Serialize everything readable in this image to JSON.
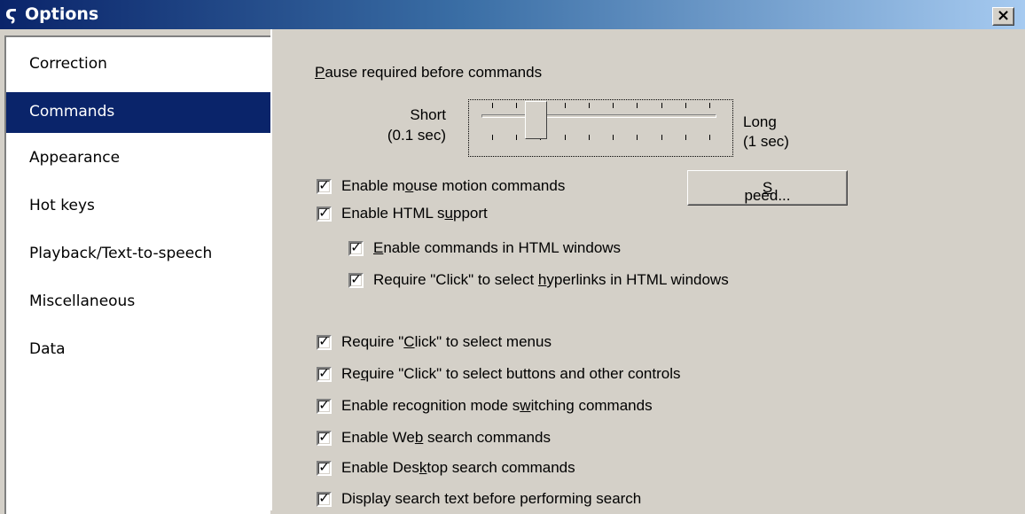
{
  "window": {
    "title": "Options",
    "logo_glyph": "(̶",
    "close_glyph": "×"
  },
  "sidebar": {
    "items": [
      {
        "label": "Correction",
        "selected": false
      },
      {
        "label": "Commands",
        "selected": true
      },
      {
        "label": "Appearance",
        "selected": false
      },
      {
        "label": "Hot keys",
        "selected": false
      },
      {
        "label": "Playback/Text-to-speech",
        "selected": false
      },
      {
        "label": "Miscellaneous",
        "selected": false
      },
      {
        "label": "Data",
        "selected": false
      }
    ]
  },
  "pause": {
    "title_pre": "",
    "title_ul": "P",
    "title_post": "ause required before commands",
    "short_label": "Short",
    "short_value": "(0.1 sec)",
    "long_label": "Long",
    "long_value": "(1 sec)",
    "level_fraction": 0.2
  },
  "speed_button": {
    "pre": "",
    "ul": "S",
    "post": "peed..."
  },
  "options": [
    {
      "pre": "Enable m",
      "ul": "o",
      "post": "use motion commands",
      "checked": true
    },
    {
      "pre": "Enable HTML s",
      "ul": "u",
      "post": "pport",
      "checked": true
    },
    {
      "pre": "",
      "ul": "E",
      "post": "nable commands in HTML windows",
      "checked": true
    },
    {
      "pre": "Require \"Click\" to select ",
      "ul": "h",
      "post": "yperlinks in HTML windows",
      "checked": true
    },
    {
      "pre": "Require \"",
      "ul": "C",
      "post": "lick\" to select menus",
      "checked": true
    },
    {
      "pre": "Re",
      "ul": "q",
      "post": "uire \"Click\" to select buttons and other controls",
      "checked": true
    },
    {
      "pre": "Enable recognition mode s",
      "ul": "w",
      "post": "itching commands",
      "checked": true
    },
    {
      "pre": "Enable We",
      "ul": "b",
      "post": " search commands",
      "checked": true
    },
    {
      "pre": "Enable Des",
      "ul": "k",
      "post": "top search commands",
      "checked": true
    },
    {
      "pre": "Display search text before performing search",
      "ul": "",
      "post": "",
      "checked": true
    }
  ],
  "check_glyph": "✓"
}
